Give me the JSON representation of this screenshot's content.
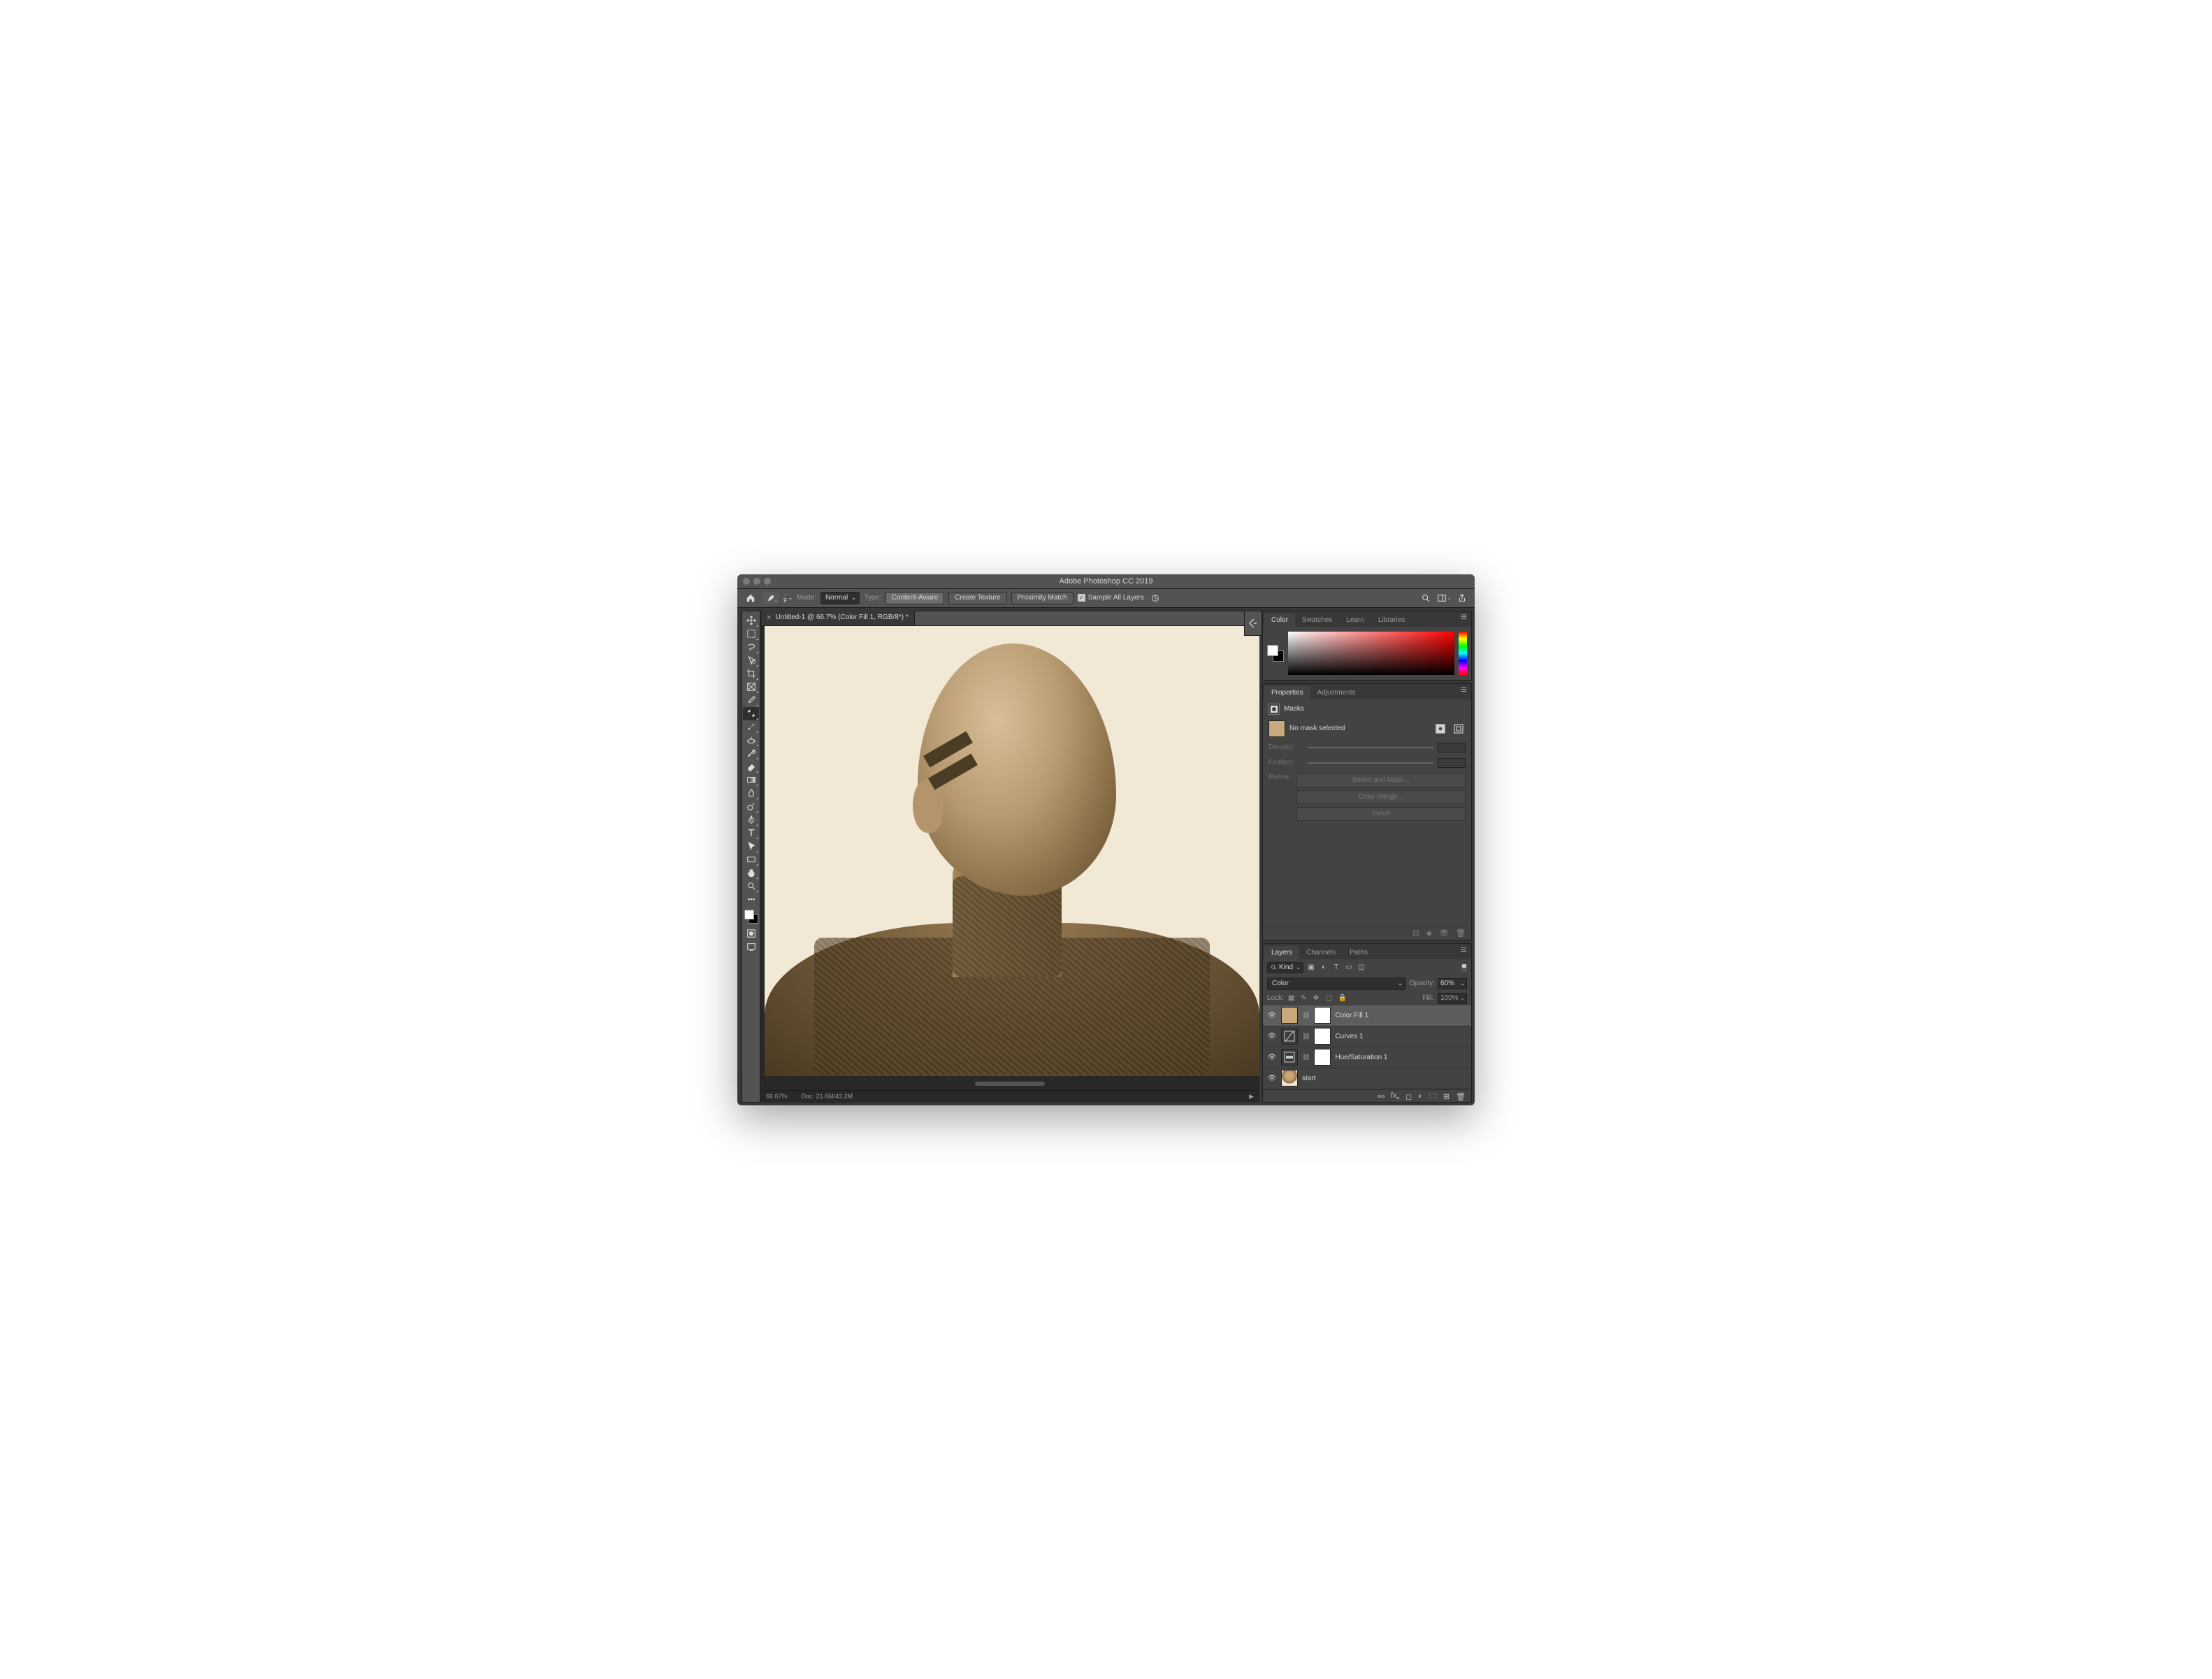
{
  "titlebar": {
    "title": "Adobe Photoshop CC 2019"
  },
  "optionsbar": {
    "brush_size": "9",
    "mode_label": "Mode:",
    "blend_mode": "Normal",
    "type_label": "Type:",
    "btn_content_aware": "Content-Aware",
    "btn_create_texture": "Create Texture",
    "btn_proximity": "Proximity Match",
    "sample_all": "Sample All Layers"
  },
  "document_tab": {
    "label": "Untitled-1 @ 66.7% (Color Fill 1, RGB/8*) *"
  },
  "statusbar": {
    "zoom": "66.67%",
    "doc": "Doc: 21.6M/43.2M"
  },
  "tools": [
    "move-tool",
    "marquee-tool",
    "lasso-tool",
    "quick-select-tool",
    "crop-tool",
    "frame-tool",
    "eyedropper-tool",
    "healing-brush-tool",
    "brush-tool",
    "clone-stamp-tool",
    "history-brush-tool",
    "eraser-tool",
    "gradient-tool",
    "blur-tool",
    "dodge-tool",
    "pen-tool",
    "type-tool",
    "path-select-tool",
    "rectangle-tool",
    "hand-tool",
    "zoom-tool"
  ],
  "selected_tool_index": 7,
  "extra_tools": [
    "edit-toolbar",
    "quick-mask",
    "screen-mode"
  ],
  "color_panel": {
    "tabs": [
      "Color",
      "Swatches",
      "Learn",
      "Libraries"
    ],
    "active_tab": 0
  },
  "props_panel": {
    "tabs": [
      "Properties",
      "Adjustments"
    ],
    "active_tab": 0,
    "heading": "Masks",
    "no_mask": "No mask selected",
    "density_label": "Density:",
    "feather_label": "Feather:",
    "refine_label": "Refine:",
    "btn_select_mask": "Select and Mask...",
    "btn_color_range": "Color Range...",
    "btn_invert": "Invert",
    "mask_thumb_color": "#c8a97d"
  },
  "layers_panel": {
    "tabs": [
      "Layers",
      "Channels",
      "Paths"
    ],
    "active_tab": 0,
    "kind_label": "Kind",
    "blend_mode": "Color",
    "opacity_label": "Opacity:",
    "opacity_value": "60%",
    "lock_label": "Lock:",
    "fill_label": "Fill:",
    "fill_value": "100%",
    "layers": [
      {
        "visible": true,
        "type": "solid",
        "thumb": "#c8a97d",
        "mask": true,
        "name": "Color Fill 1",
        "selected": true
      },
      {
        "visible": true,
        "type": "curves",
        "mask": true,
        "name": "Curves 1",
        "selected": false
      },
      {
        "visible": true,
        "type": "huesat",
        "mask": true,
        "name": "Hue/Saturation 1",
        "selected": false
      },
      {
        "visible": true,
        "type": "image",
        "name": "start",
        "selected": false
      }
    ]
  }
}
